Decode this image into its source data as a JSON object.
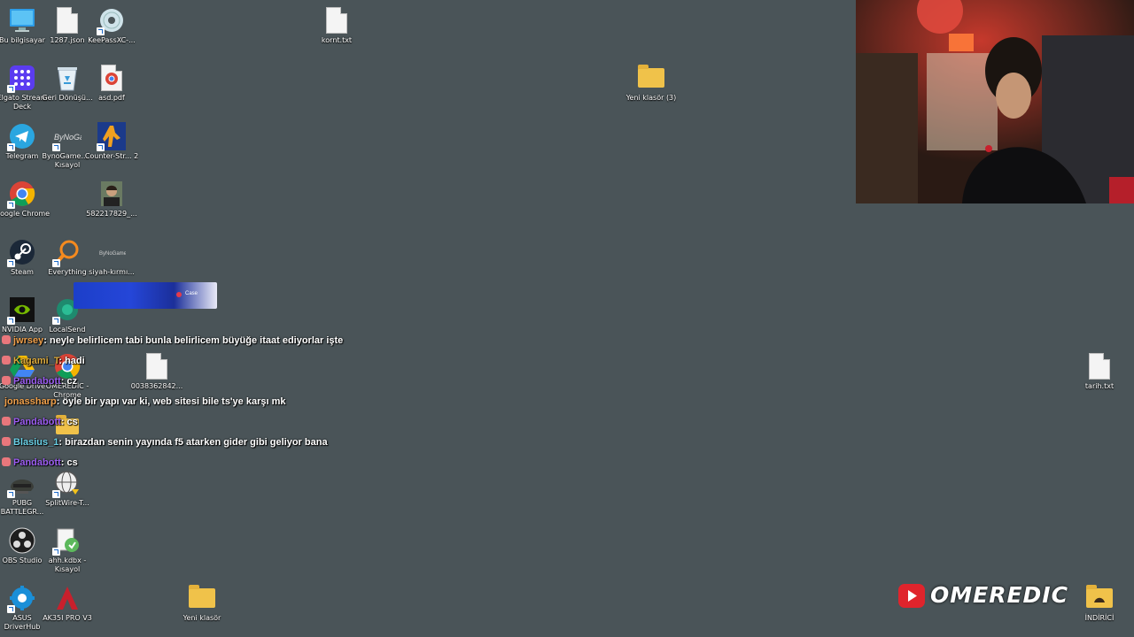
{
  "desktop": {
    "icons": {
      "bu_bilgisayar": "Bu bilgisayar",
      "json_1287": "1287.json",
      "keepass": "KeePassXC-...",
      "kornt_txt": "kornt.txt",
      "elgato": "Elgato Stream Deck",
      "geri_donusum": "Geri Dönüşü...",
      "asd_pdf": "asd.pdf",
      "yeni_klasor_3": "Yeni klasör (3)",
      "telegram": "Telegram",
      "bynogame": "BynoGame... - Kısayol",
      "counter_strike": "Counter-Str... 2",
      "chrome": "Google Chrome",
      "photo": "582217829_...",
      "steam": "Steam",
      "everything": "Everything",
      "siyah_kirmizi": "siyah-kırmı...",
      "nvidia": "NVIDIA App",
      "localsend": "LocalSend",
      "google_drive": "Google Drive",
      "omeredic_chrome": "OMEREDİC - Chrome",
      "file_0038": "0038362842...",
      "tarih_txt": "tarih.txt",
      "pubg": "PUBG BATTLEGR...",
      "splitwire": "SplitWire-T...",
      "obs": "OBS Studio",
      "ahh_kdbx": "ahh.kdbx - Kısayol",
      "asus": "ASUS DriverHub",
      "ak35i": "AK35I PRO V3",
      "yeni_klasor": "Yeni klasör",
      "indirici": "İNDİRİCİ"
    }
  },
  "banner": {
    "brand": "Case"
  },
  "chat": [
    {
      "user": "jwrsey",
      "user_color": "#f0a04b",
      "msg": ": neyle belirlicem tabi bunla belirlicem büyüğe itaat ediyorlar işte"
    },
    {
      "user": "Kagami_T",
      "user_color": "#d9a83c",
      "msg": ": hadi"
    },
    {
      "user": "Pandabott",
      "user_color": "#9b5cf0",
      "msg": ": cz"
    },
    {
      "user": "jonassharp",
      "user_color": "#f0a04b",
      "msg": ": öyle bir yapı var ki, web sitesi bile ts'ye karşı mk"
    },
    {
      "user": "Pandabott",
      "user_color": "#9b5cf0",
      "msg": ": cs"
    },
    {
      "user": "Blasius_1",
      "user_color": "#6ad0e6",
      "msg": ": birazdan senin yayında f5 atarken gider gibi geliyor bana"
    },
    {
      "user": "Pandabott",
      "user_color": "#9b5cf0",
      "msg": ": cs"
    }
  ],
  "logo": {
    "text": "OMEREDIC"
  },
  "colors": {
    "desktop_bg": "#4a5458",
    "folder": "#f0c24a",
    "banner": "#2546d8"
  }
}
